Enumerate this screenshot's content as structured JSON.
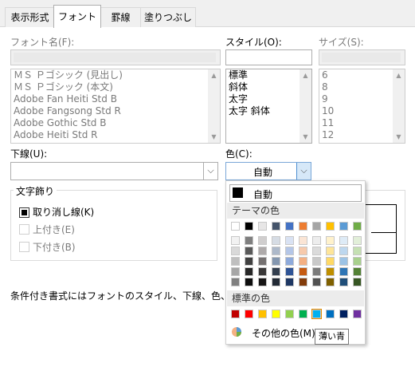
{
  "tabs": [
    "表示形式",
    "フォント",
    "罫線",
    "塗りつぶし"
  ],
  "active_tab": "フォント",
  "font_name": {
    "label": "フォント名(F):",
    "value": "",
    "items": [
      "ＭＳ Ｐゴシック (見出し)",
      "ＭＳ Ｐゴシック (本文)",
      "Adobe Fan Heiti Std B",
      "Adobe Fangsong Std R",
      "Adobe Gothic Std B",
      "Adobe Heiti Std R"
    ]
  },
  "style": {
    "label": "スタイル(O):",
    "value": "",
    "items": [
      "標準",
      "斜体",
      "太字",
      "太字 斜体"
    ]
  },
  "size": {
    "label": "サイズ(S):",
    "value": "",
    "items": [
      "6",
      "8",
      "9",
      "10",
      "11",
      "12"
    ]
  },
  "underline": {
    "label": "下線(U):",
    "value": ""
  },
  "color": {
    "label": "色(C):",
    "value": "自動"
  },
  "effects": {
    "title": "文字飾り",
    "strikethrough": "取り消し線(K)",
    "superscript": "上付き(E)",
    "subscript": "下付き(B)"
  },
  "footer_text": "条件付き書式にはフォントのスタイル、下線、色、および取り",
  "color_popup": {
    "auto_label": "自動",
    "theme_header": "テーマの色",
    "standard_header": "標準の色",
    "more_colors": "その他の色(M)...",
    "tooltip": "薄い青",
    "theme_top": [
      "#ffffff",
      "#000000",
      "#e7e6e6",
      "#44546a",
      "#4472c4",
      "#ed7d31",
      "#a5a5a5",
      "#ffc000",
      "#5b9bd5",
      "#70ad47"
    ],
    "theme_shades": [
      [
        "#f2f2f2",
        "#d9d9d9",
        "#bfbfbf",
        "#a6a6a6",
        "#808080"
      ],
      [
        "#7f7f7f",
        "#595959",
        "#404040",
        "#262626",
        "#0d0d0d"
      ],
      [
        "#d0cece",
        "#aeaaaa",
        "#757171",
        "#3a3838",
        "#171616"
      ],
      [
        "#d6dce4",
        "#adb9ca",
        "#8497b0",
        "#333f4f",
        "#222a35"
      ],
      [
        "#d9e2f3",
        "#b4c6e7",
        "#8eaadb",
        "#2f5496",
        "#1f3864"
      ],
      [
        "#fbe5d5",
        "#f7caac",
        "#f4b083",
        "#c55a11",
        "#833c0b"
      ],
      [
        "#ededed",
        "#dbdbdb",
        "#c9c9c9",
        "#7b7b7b",
        "#525252"
      ],
      [
        "#fff2cc",
        "#fee599",
        "#ffd965",
        "#bf8f00",
        "#7f6000"
      ],
      [
        "#deebf6",
        "#bdd7ee",
        "#9cc3e5",
        "#2e75b5",
        "#1f4e79"
      ],
      [
        "#e2efd9",
        "#c5e0b3",
        "#a8d08d",
        "#538135",
        "#375623"
      ]
    ],
    "standard": [
      "#c00000",
      "#ff0000",
      "#ffc000",
      "#ffff00",
      "#92d050",
      "#00b050",
      "#00b0f0",
      "#0070c0",
      "#002060",
      "#7030a0"
    ],
    "selected_standard_index": 6
  }
}
